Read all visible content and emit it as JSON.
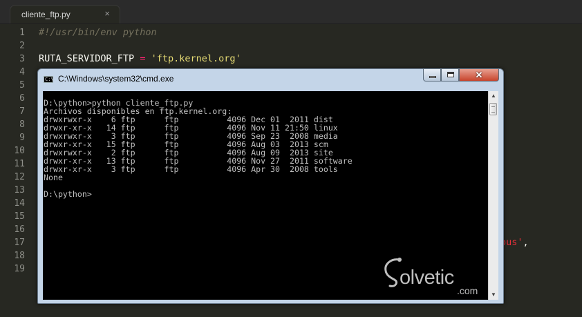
{
  "editor": {
    "tab": {
      "label": "cliente_ftp.py",
      "close": "×"
    },
    "line_numbers": [
      "1",
      "2",
      "3",
      "4",
      "5",
      "6",
      "7",
      "8",
      "9",
      "10",
      "11",
      "12",
      "13",
      "14",
      "15",
      "16",
      "17",
      "18",
      "19"
    ],
    "line1": "#!/usr/bin/env python",
    "line3": {
      "var": "RUTA_SERVIDOR_FTP",
      "op": "=",
      "str": "'ftp.kernel.org'"
    },
    "line17": {
      "str": "ous'",
      "punct": ","
    }
  },
  "cmd": {
    "title": "C:\\Windows\\system32\\cmd.exe",
    "icon_text": "C:\\",
    "close_glyph": "✕",
    "output": "D:\\python>python cliente_ftp.py\nArchivos disponibles en ftp.kernel.org:\ndrwxrwxr-x    6 ftp      ftp          4096 Dec 01  2011 dist\ndrwxr-xr-x   14 ftp      ftp          4096 Nov 11 21:50 linux\ndrwxrwxr-x    3 ftp      ftp          4096 Sep 23  2008 media\ndrwxr-xr-x   15 ftp      ftp          4096 Aug 03  2013 scm\ndrwxrwxr-x    2 ftp      ftp          4096 Aug 09  2013 site\ndrwxr-xr-x   13 ftp      ftp          4096 Nov 27  2011 software\ndrwxr-xr-x    3 ftp      ftp          4096 Apr 30  2008 tools\nNone\n\nD:\\python>"
  },
  "watermark": {
    "text": "olvetic",
    "domain": ".com"
  }
}
